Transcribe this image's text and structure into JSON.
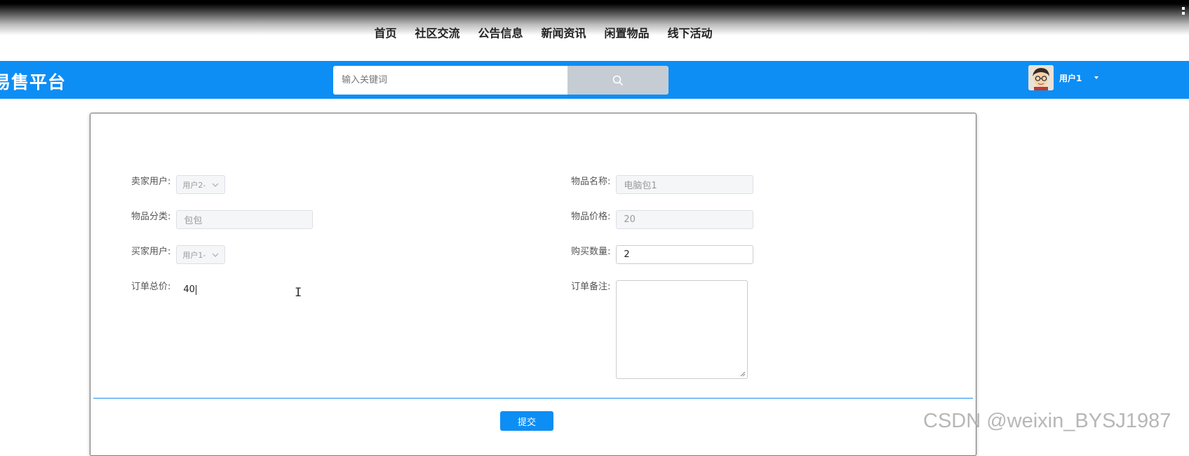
{
  "nav": {
    "items": [
      "首页",
      "社区交流",
      "公告信息",
      "新闻资讯",
      "闲置物品",
      "线下活动"
    ]
  },
  "header": {
    "brand": "品易售平台",
    "search_placeholder": "输入关键词",
    "username": "用户1"
  },
  "form": {
    "seller_label": "卖家用户:",
    "seller_value": "用户2-",
    "item_name_label": "物品名称:",
    "item_name_value": "电脑包1",
    "category_label": "物品分类:",
    "category_value": "包包",
    "price_label": "物品价格:",
    "price_value": "20",
    "buyer_label": "买家用户:",
    "buyer_value": "用户1-",
    "quantity_label": "购买数量:",
    "quantity_value": "2",
    "total_label": "订单总价:",
    "total_value": "40",
    "remark_label": "订单备注:",
    "remark_value": "",
    "submit_label": "提交"
  },
  "watermark": "CSDN @weixin_BYSJ1987",
  "colors": {
    "primary": "#0d8ef5",
    "search_button": "#c5ccd3",
    "divider": "#1a8ef0"
  }
}
